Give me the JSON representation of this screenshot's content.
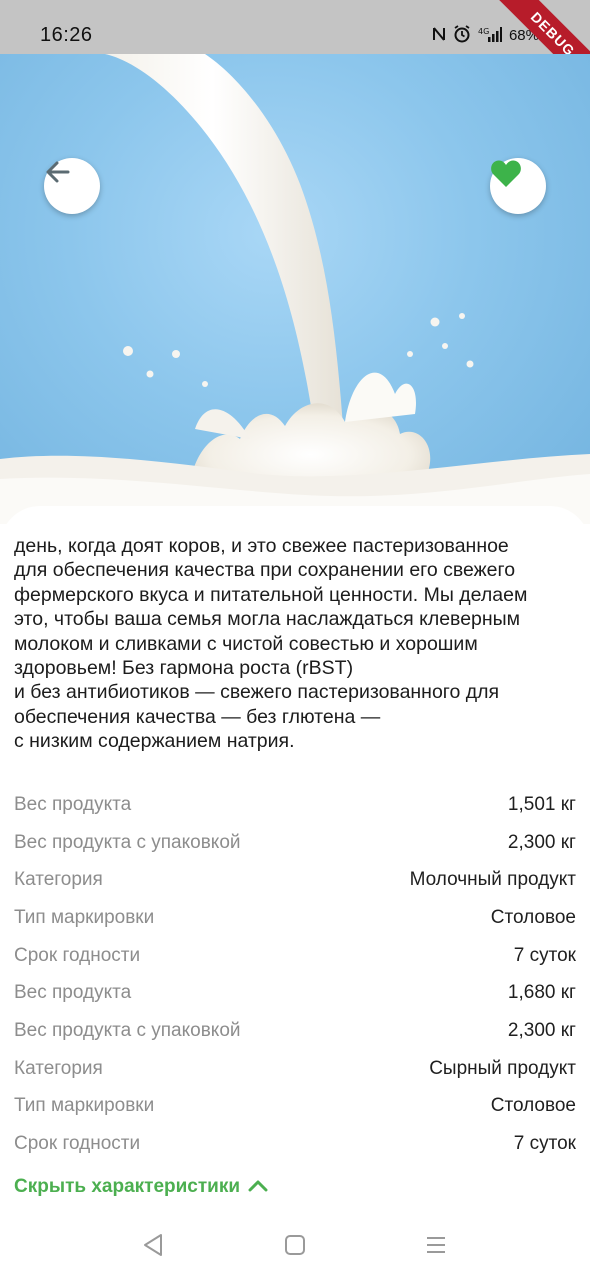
{
  "status_bar": {
    "time": "16:26",
    "signal_text": "⁴ᴳ",
    "battery": "68%",
    "debug_label": "DEBUG",
    "icons": [
      "nfc-icon",
      "alarm-icon",
      "signal-icon",
      "battery-icon"
    ]
  },
  "hero": {
    "image": "milk-splash-illustration",
    "back_icon": "arrow-left-icon",
    "favorite_icon": "heart-icon",
    "favorite_color": "#3db34a",
    "background_color": "#8cc6ec"
  },
  "description": {
    "lines": [
      "день, когда доят коров, и это свежее пастеризованное",
      "для обеспечения качества при сохранении его свежего",
      "фермерского вкуса и питательной ценности. Мы делаем",
      "это, чтобы ваша семья могла наслаждаться клеверным",
      "молоком и сливками с чистой совестью и хорошим",
      "здоровьем! Без гармона роста (rBST)",
      "и без антибиотиков — свежего пастеризованного для",
      "обеспечения качества — без глютена —",
      "с низким содержанием натрия."
    ]
  },
  "specs": [
    {
      "label": "Вес продукта",
      "value": "1,501 кг"
    },
    {
      "label": "Вес продукта с упаковкой",
      "value": "2,300 кг"
    },
    {
      "label": "Категория",
      "value": "Молочный продукт"
    },
    {
      "label": "Тип маркировки",
      "value": "Столовое"
    },
    {
      "label": "Срок годности",
      "value": "7 суток"
    },
    {
      "label": "Вес продукта",
      "value": "1,680 кг"
    },
    {
      "label": "Вес продукта с упаковкой",
      "value": "2,300 кг"
    },
    {
      "label": "Категория",
      "value": "Сырный продукт"
    },
    {
      "label": "Тип маркировки",
      "value": "Столовое"
    },
    {
      "label": "Срок годности",
      "value": "7 суток"
    }
  ],
  "toggle": {
    "label": "Скрыть характеристики",
    "icon": "chevron-up-icon",
    "color": "#4caf50"
  },
  "nav_bar": {
    "icons": [
      "nav-back-icon",
      "nav-home-icon",
      "nav-menu-icon"
    ]
  }
}
